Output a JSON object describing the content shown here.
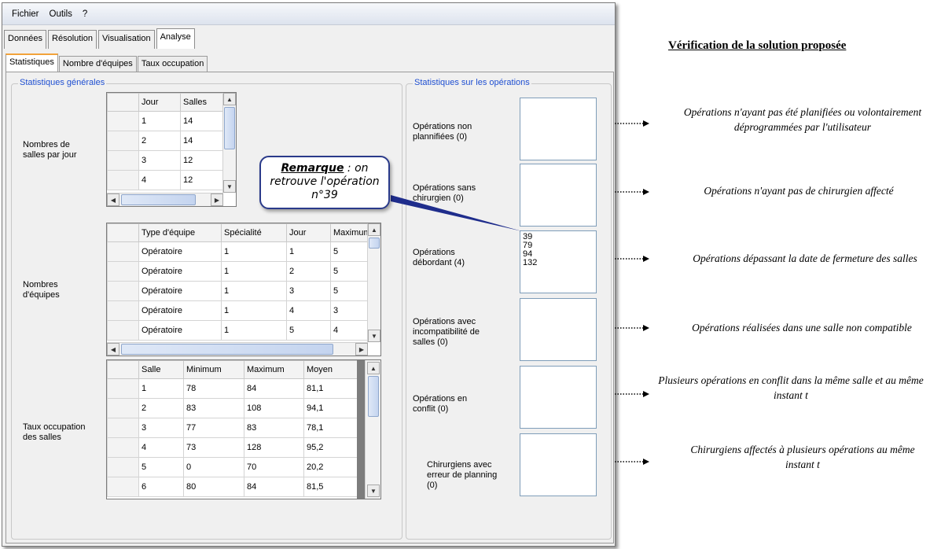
{
  "menu": [
    "Fichier",
    "Outils",
    "?"
  ],
  "main_tabs": [
    {
      "label": "Données"
    },
    {
      "label": "Résolution"
    },
    {
      "label": "Visualisation"
    },
    {
      "label": "Analyse"
    }
  ],
  "sub_tabs": [
    {
      "label": "Statistiques"
    },
    {
      "label": "Nombre d'équipes"
    },
    {
      "label": "Taux occupation"
    }
  ],
  "stats_general": {
    "title": "Statistiques générales",
    "salles": {
      "label": "Nombres de salles par jour",
      "headers": [
        "Jour",
        "Salles"
      ],
      "rows": [
        [
          "1",
          "14"
        ],
        [
          "2",
          "14"
        ],
        [
          "3",
          "12"
        ],
        [
          "4",
          "12"
        ]
      ]
    },
    "equipes": {
      "label": "Nombres d'équipes",
      "headers": [
        "Type d'équipe",
        "Spécialité",
        "Jour",
        "Maximum"
      ],
      "rows": [
        [
          "Opératoire",
          "1",
          "1",
          "5"
        ],
        [
          "Opératoire",
          "1",
          "2",
          "5"
        ],
        [
          "Opératoire",
          "1",
          "3",
          "5"
        ],
        [
          "Opératoire",
          "1",
          "4",
          "3"
        ],
        [
          "Opératoire",
          "1",
          "5",
          "4"
        ]
      ]
    },
    "taux": {
      "label": "Taux occupation des salles",
      "headers": [
        "Salle",
        "Minimum",
        "Maximum",
        "Moyen"
      ],
      "rows": [
        [
          "1",
          "78",
          "84",
          "81,1"
        ],
        [
          "2",
          "83",
          "108",
          "94,1"
        ],
        [
          "3",
          "77",
          "83",
          "78,1"
        ],
        [
          "4",
          "73",
          "128",
          "95,2"
        ],
        [
          "5",
          "0",
          "70",
          "20,2"
        ],
        [
          "6",
          "80",
          "84",
          "81,5"
        ]
      ]
    }
  },
  "stats_operations": {
    "title": "Statistiques sur les opérations",
    "items": [
      {
        "label": "Opérations non plannifiées (0)",
        "values": []
      },
      {
        "label": "Opérations sans chirurgien (0)",
        "values": []
      },
      {
        "label": "Opérations débordant (4)",
        "values": [
          "39",
          "79",
          "94",
          "132"
        ]
      },
      {
        "label": "Opérations avec incompatibilité de salles  (0)",
        "values": []
      },
      {
        "label": "Opérations en conflit  (0)",
        "values": []
      },
      {
        "label": "Chirurgiens avec erreur de planning (0)",
        "values": []
      }
    ]
  },
  "remark": {
    "title": "Remarque",
    "text_after": " : on retrouve l'opération n°39"
  },
  "annotations": {
    "title": "Vérification de la solution proposée",
    "notes": [
      "Opérations n'ayant pas été planifiées ou volontairement déprogrammées par l'utilisateur",
      "Opérations n'ayant pas de chirurgien affecté",
      "Opérations dépassant la date de fermeture des salles",
      "Opérations réalisées dans une salle non compatible",
      "Plusieurs opérations en conflit dans la même salle et au même instant t",
      "Chirurgiens affectés à plusieurs opérations au même instant t"
    ]
  },
  "colors": {
    "group_title": "#1f4fd1",
    "callout_line": "#1f2d8c",
    "active_subtab_accent": "#f2a23a"
  }
}
